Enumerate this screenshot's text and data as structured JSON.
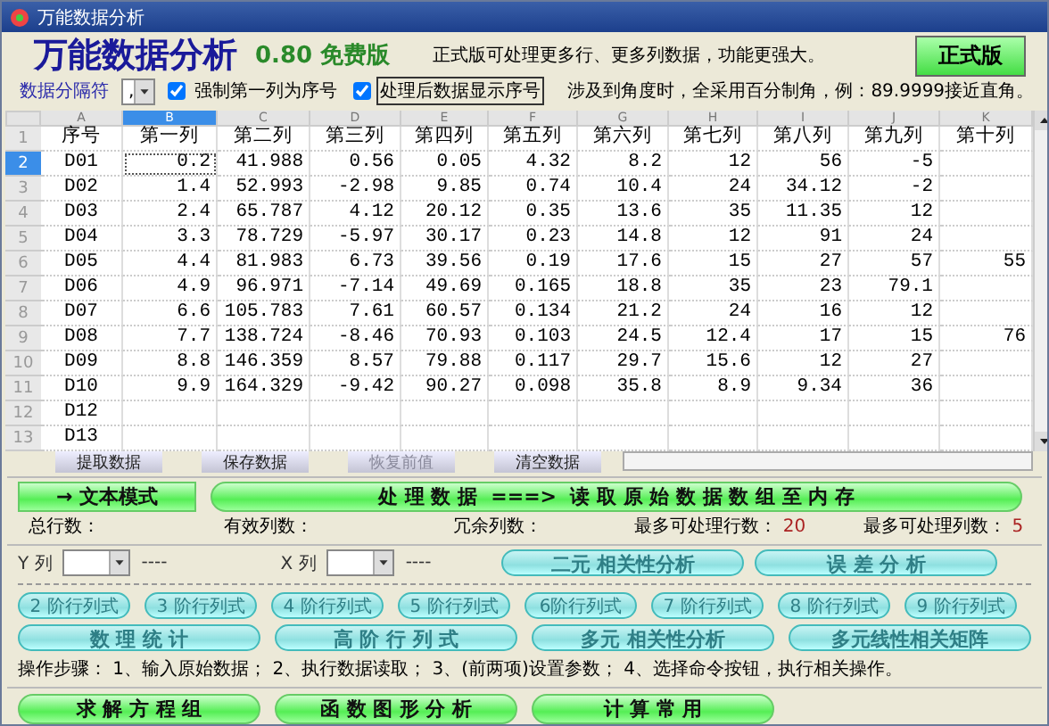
{
  "window": {
    "title": "万能数据分析"
  },
  "header": {
    "title": "万能数据分析",
    "version": "0.80 免费版",
    "promo": "正式版可处理更多行、更多列数据，功能更强大。",
    "pro_button": "正式版"
  },
  "options": {
    "separator_label": "数据分隔符",
    "separator_value": ",",
    "checkboxes": [
      {
        "label": "强制第一列为序号",
        "checked": true,
        "focused": false
      },
      {
        "label": "处理后数据显示序号",
        "checked": true,
        "focused": true
      }
    ],
    "note": "涉及到角度时，全采用百分制角，例：89.9999接近直角。"
  },
  "grid": {
    "columns": [
      {
        "letter": "A",
        "selected": false
      },
      {
        "letter": "B",
        "selected": true
      },
      {
        "letter": "C",
        "selected": false
      },
      {
        "letter": "D",
        "selected": false
      },
      {
        "letter": "E",
        "selected": false
      },
      {
        "letter": "F",
        "selected": false
      },
      {
        "letter": "G",
        "selected": false
      },
      {
        "letter": "H",
        "selected": false
      },
      {
        "letter": "I",
        "selected": false
      },
      {
        "letter": "J",
        "selected": false
      },
      {
        "letter": "K",
        "selected": false
      }
    ],
    "rows": [
      {
        "num": "1",
        "selected": false,
        "cells": [
          "序号",
          "第一列",
          "第二列",
          "第三列",
          "第四列",
          "第五列",
          "第六列",
          "第七列",
          "第八列",
          "第九列",
          "第十列"
        ]
      },
      {
        "num": "2",
        "selected": true,
        "cells": [
          "D01",
          "0.2",
          "41.988",
          "0.56",
          "0.05",
          "4.32",
          "8.2",
          "12",
          "56",
          "-5",
          null
        ]
      },
      {
        "num": "3",
        "selected": false,
        "cells": [
          "D02",
          "1.4",
          "52.993",
          "-2.98",
          "9.85",
          "0.74",
          "10.4",
          "24",
          "34.12",
          "-2",
          null
        ]
      },
      {
        "num": "4",
        "selected": false,
        "cells": [
          "D03",
          "2.4",
          "65.787",
          "4.12",
          "20.12",
          "0.35",
          "13.6",
          "35",
          "11.35",
          "12",
          null
        ]
      },
      {
        "num": "5",
        "selected": false,
        "cells": [
          "D04",
          "3.3",
          "78.729",
          "-5.97",
          "30.17",
          "0.23",
          "14.8",
          "12",
          "91",
          "24",
          null
        ]
      },
      {
        "num": "6",
        "selected": false,
        "cells": [
          "D05",
          "4.4",
          "81.983",
          "6.73",
          "39.56",
          "0.19",
          "17.6",
          "15",
          "27",
          "57",
          "55"
        ]
      },
      {
        "num": "7",
        "selected": false,
        "cells": [
          "D06",
          "4.9",
          "96.971",
          "-7.14",
          "49.69",
          "0.165",
          "18.8",
          "35",
          "23",
          "79.1",
          null
        ]
      },
      {
        "num": "8",
        "selected": false,
        "cells": [
          "D07",
          "6.6",
          "105.783",
          "7.61",
          "60.57",
          "0.134",
          "21.2",
          "24",
          "16",
          "12",
          null
        ]
      },
      {
        "num": "9",
        "selected": false,
        "cells": [
          "D08",
          "7.7",
          "138.724",
          "-8.46",
          "70.93",
          "0.103",
          "24.5",
          "12.4",
          "17",
          "15",
          "76"
        ]
      },
      {
        "num": "10",
        "selected": false,
        "cells": [
          "D09",
          "8.8",
          "146.359",
          "8.57",
          "79.88",
          "0.117",
          "29.7",
          "15.6",
          "12",
          "27",
          null
        ]
      },
      {
        "num": "11",
        "selected": false,
        "cells": [
          "D10",
          "9.9",
          "164.329",
          "-9.42",
          "90.27",
          "0.098",
          "35.8",
          "8.9",
          "9.34",
          "36",
          null
        ]
      },
      {
        "num": "12",
        "selected": false,
        "cells": [
          "D12",
          null,
          null,
          null,
          null,
          null,
          null,
          null,
          null,
          null,
          null
        ]
      },
      {
        "num": "13",
        "selected": false,
        "cells": [
          "D13",
          null,
          null,
          null,
          null,
          null,
          null,
          null,
          null,
          null,
          null
        ]
      }
    ]
  },
  "grid_buttons": [
    {
      "label": "提取数据",
      "disabled": false
    },
    {
      "label": "保存数据",
      "disabled": false
    },
    {
      "label": "恢复前值",
      "disabled": true
    },
    {
      "label": "清空数据",
      "disabled": false
    }
  ],
  "mode_button": "→ 文本模式",
  "process_button": "处 理 数 据  ===>  读 取 原 始 数 据 数 组 至 内 存",
  "stats": [
    {
      "label": "总行数："
    },
    {
      "label": "有效列数："
    },
    {
      "label": "冗余列数："
    },
    {
      "label": "最多可处理行数：",
      "value": "20"
    },
    {
      "label": "最多可处理列数：",
      "value": "5"
    }
  ],
  "axes": [
    {
      "label": "Y 列",
      "value_text": "----"
    },
    {
      "label": "X 列",
      "value_text": "----"
    }
  ],
  "axis_buttons": [
    {
      "label": "二元 相关性分析",
      "disabled": true
    },
    {
      "label": "误 差 分 析",
      "disabled": true
    }
  ],
  "determinant_buttons": [
    {
      "label": "2 阶行列式",
      "disabled": true
    },
    {
      "label": "3 阶行列式",
      "disabled": true
    },
    {
      "label": "4 阶行列式",
      "disabled": true
    },
    {
      "label": "5 阶行列式",
      "disabled": true
    },
    {
      "label": "6阶行列式",
      "disabled": true
    },
    {
      "label": "7 阶行列式",
      "disabled": true
    },
    {
      "label": "8 阶行列式",
      "disabled": true
    },
    {
      "label": "9 阶行列式",
      "disabled": true
    }
  ],
  "analysis_buttons": [
    {
      "label": "数 理 统 计",
      "disabled": true
    },
    {
      "label": "高 阶 行 列 式",
      "disabled": true
    },
    {
      "label": "多元 相关性分析",
      "disabled": true
    },
    {
      "label": "多元线性相关矩阵",
      "disabled": true
    }
  ],
  "steps": "操作步骤： 1、输入原始数据； 2、执行数据读取； 3、(前两项)设置参数； 4、选择命令按钮，执行相关操作。",
  "tool_buttons": [
    {
      "label": "求 解 方 程 组"
    },
    {
      "label": "函 数 图 形 分 析"
    },
    {
      "label": "计 算 常 用"
    }
  ]
}
